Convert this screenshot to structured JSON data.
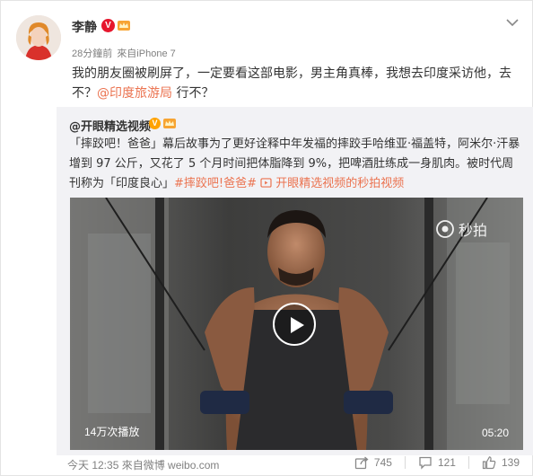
{
  "post": {
    "username": "李静",
    "time": "28分鐘前",
    "source": "來自iPhone 7",
    "text_part1": "我的朋友圈被刷屏了，一定要看这部电影，男主角真棒，我想去印度采访他，去不？",
    "mention": "@印度旅游局",
    "text_part2": " 行不？"
  },
  "repost": {
    "username": "@开眼精选视频",
    "text_part1": "「摔跤吧！爸爸」幕后故事为了更好诠释中年发福的摔跤手哈维亚·福盖特，阿米尔·汗暴增到 97 公斤，又花了 5 个月时间把体脂降到 9%，把啤酒肚练成一身肌肉。被时代周刊称为「印度良心」",
    "hashtag": "#摔跤吧!爸爸#",
    "video_link": "开眼精选视频的秒拍视频",
    "video": {
      "watermark": "秒拍",
      "views": "14万次播放",
      "duration": "05:20"
    }
  },
  "footer": {
    "time_source": "今天 12:35 來自微博 weibo.com",
    "share_count": "745",
    "comment_count": "121",
    "like_count": "139"
  },
  "colors": {
    "link": "#eb7350",
    "verified_red": "#e6162d",
    "verified_orange": "#ffa200",
    "repost_bg": "#f2f2f5"
  },
  "icons": {
    "badge": "verified-v-icon",
    "crown": "member-crown-icon",
    "menu": "chevron-down-icon",
    "share": "share-icon",
    "comment": "comment-icon",
    "like": "like-icon",
    "play": "play-icon",
    "video_link": "video-link-icon"
  }
}
